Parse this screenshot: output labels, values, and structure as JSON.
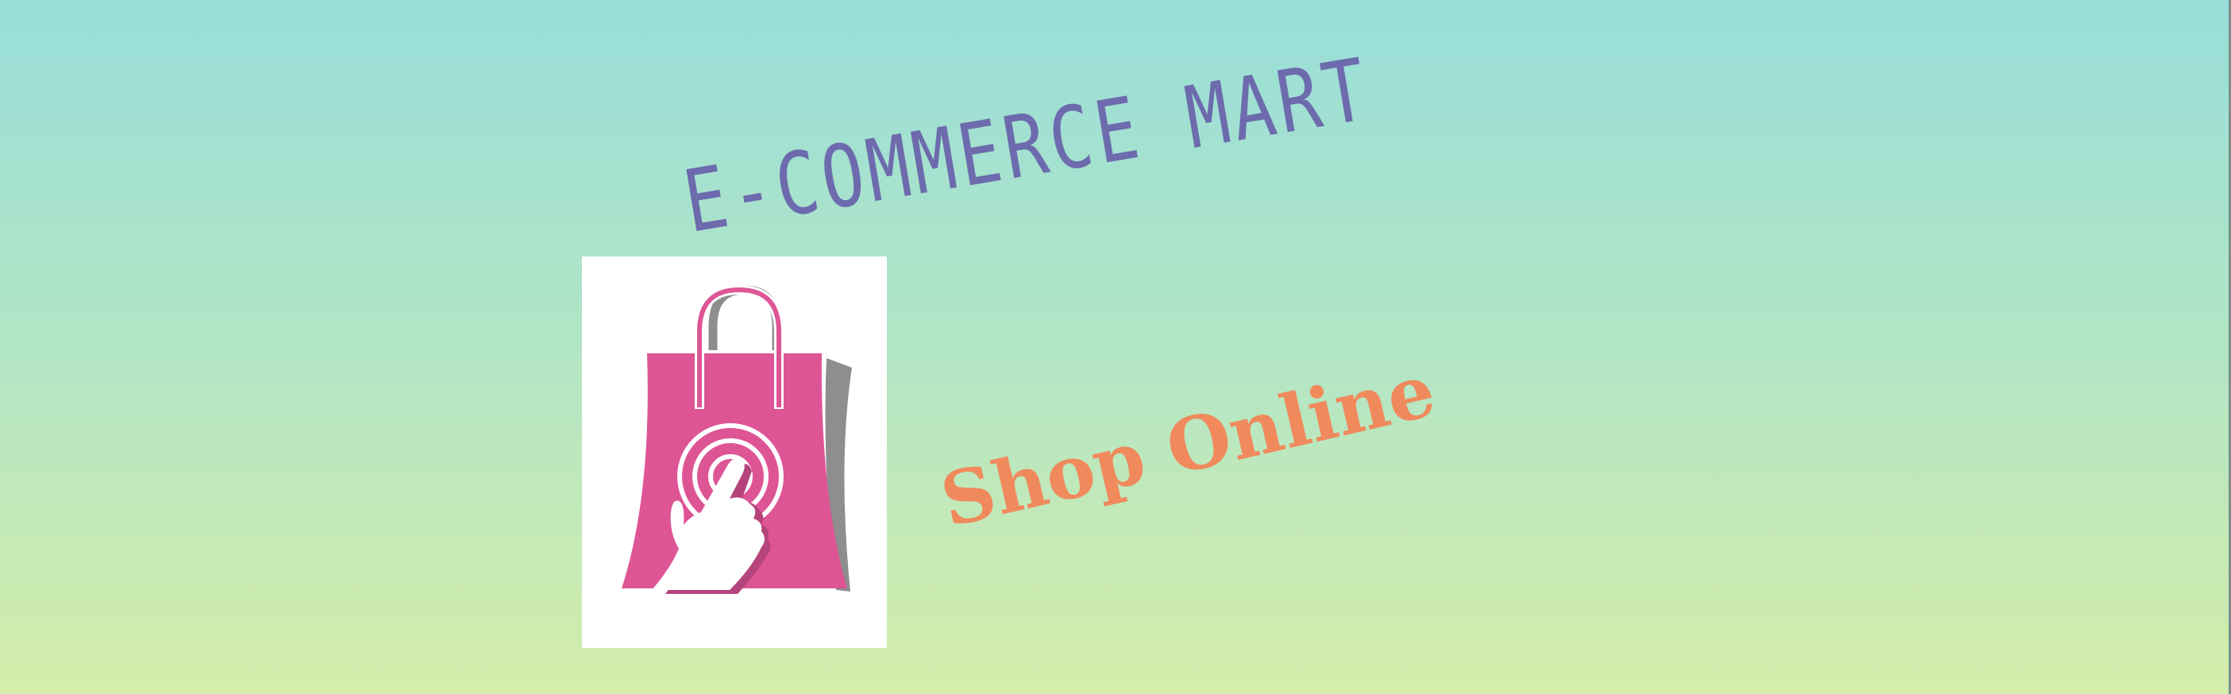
{
  "banner": {
    "title": "E-COMMERCE MART",
    "tagline": "Shop Online"
  },
  "logo": {
    "icon": "shopping-bag-with-tap-icon"
  },
  "colors": {
    "background_top": "#98ded9",
    "background_bottom": "#d4edaa",
    "title": "#6d6bad",
    "tagline": "#f08a5d",
    "bag": "#de5596",
    "bag_shade": "#8e8e8e",
    "card": "#ffffff"
  }
}
